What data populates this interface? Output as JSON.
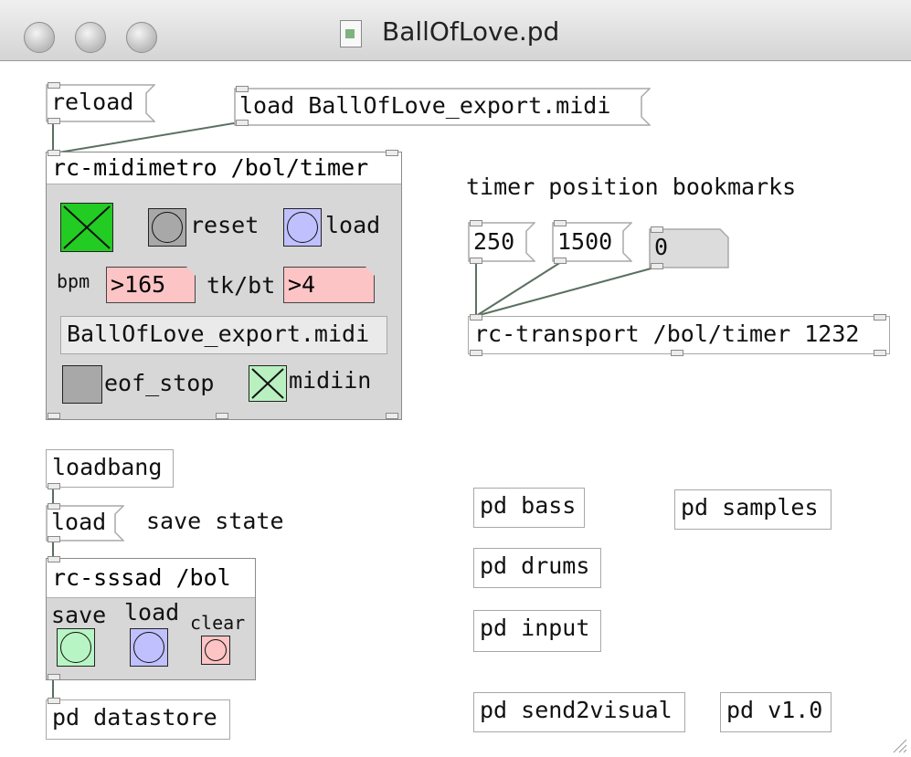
{
  "window": {
    "title": "BallOfLove.pd"
  },
  "patch": {
    "msg_reload": "reload",
    "msg_load_midi": "load BallOfLove_export.midi",
    "midimetro": {
      "header": "rc-midimetro /bol/timer",
      "reset_label": "reset",
      "load_label": "load",
      "bpm_label": "bpm",
      "bpm_value": ">165",
      "tkbt_label": "tk/bt",
      "tkbt_value": ">4",
      "filename": "BallOfLove_export.midi",
      "eof_label": "eof_stop",
      "midiin_label": "midiin",
      "colors": {
        "toggle_on": "#22cc22",
        "toggle_light": "#b8f0c0",
        "bang_load": "#c0c0ff",
        "number_box": "#fcc4c4"
      }
    },
    "bookmarks_comment": "timer position bookmarks",
    "bookmark_msgs": [
      "250",
      "1500",
      "0"
    ],
    "transport": "rc-transport /bol/timer 1232",
    "loadbang": "loadbang",
    "msg_load": "load",
    "save_state_comment": "save state",
    "sssad": {
      "header": "rc-sssad /bol",
      "save_label": "save",
      "load_label": "load",
      "clear_label": "clear",
      "colors": {
        "save": "#b8f5c4",
        "load": "#c0c0ff",
        "clear": "#fcc4c4"
      }
    },
    "datastore": "pd datastore",
    "subpatches": {
      "bass": "pd bass",
      "samples": "pd samples",
      "drums": "pd drums",
      "input": "pd input",
      "send2visual": "pd send2visual",
      "v10": "pd v1.0"
    }
  }
}
